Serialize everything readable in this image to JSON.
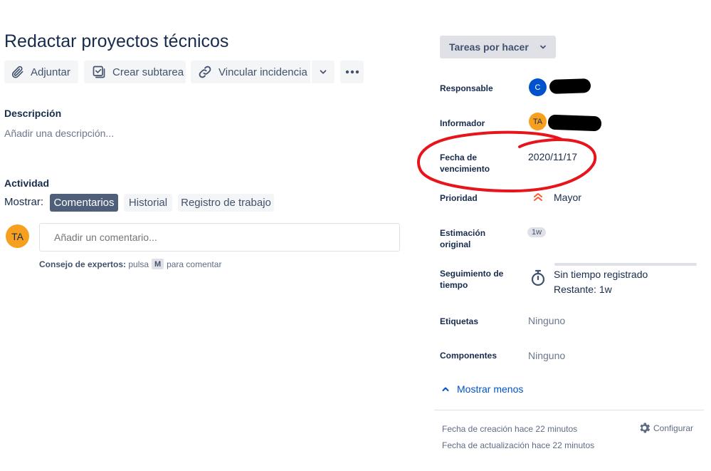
{
  "issue": {
    "title": "Redactar proyectos técnicos"
  },
  "toolbar": {
    "attach_label": "Adjuntar",
    "subtask_label": "Crear subtarea",
    "link_label": "Vincular incidencia"
  },
  "description": {
    "heading": "Descripción",
    "placeholder": "Añadir una descripción..."
  },
  "activity": {
    "heading": "Actividad",
    "show_label": "Mostrar:",
    "tabs": [
      {
        "label": "Comentarios",
        "active": true
      },
      {
        "label": "Historial",
        "active": false
      },
      {
        "label": "Registro de trabajo",
        "active": false
      }
    ],
    "user_initials": "TA",
    "comment_placeholder": "Añadir un comentario...",
    "tip_bold": "Consejo de expertos:",
    "tip_prefix": "pulsa",
    "tip_key": "M",
    "tip_suffix": "para comentar"
  },
  "status": {
    "label": "Tareas por hacer"
  },
  "fields": {
    "assignee": {
      "label": "Responsable",
      "avatar_initials": "C"
    },
    "reporter": {
      "label": "Informador",
      "avatar_initials": "TA"
    },
    "due_date": {
      "label_line1": "Fecha de",
      "label_line2": "vencimiento",
      "value": "2020/11/17"
    },
    "priority": {
      "label": "Prioridad",
      "value": "Mayor"
    },
    "estimate": {
      "label_line1": "Estimación",
      "label_line2": "original",
      "value": "1w"
    },
    "tracking": {
      "label_line1": "Seguimiento de",
      "label_line2": "tiempo",
      "logged": "Sin tiempo registrado",
      "remaining": "Restante: 1w"
    },
    "labels": {
      "label": "Etiquetas",
      "value": "Ninguno"
    },
    "components": {
      "label": "Componentes",
      "value": "Ninguno"
    }
  },
  "show_less": "Mostrar menos",
  "meta": {
    "created": "Fecha de creación hace 22 minutos",
    "updated": "Fecha de actualización hace 22 minutos",
    "configure": "Configurar"
  },
  "colors": {
    "active_tab": "#505f79",
    "link_blue": "#0052cc",
    "priority_red": "#ff5630",
    "annotation_red": "#e8141b",
    "avatar_orange": "#f79f1f",
    "avatar_blue": "#0052cc"
  }
}
